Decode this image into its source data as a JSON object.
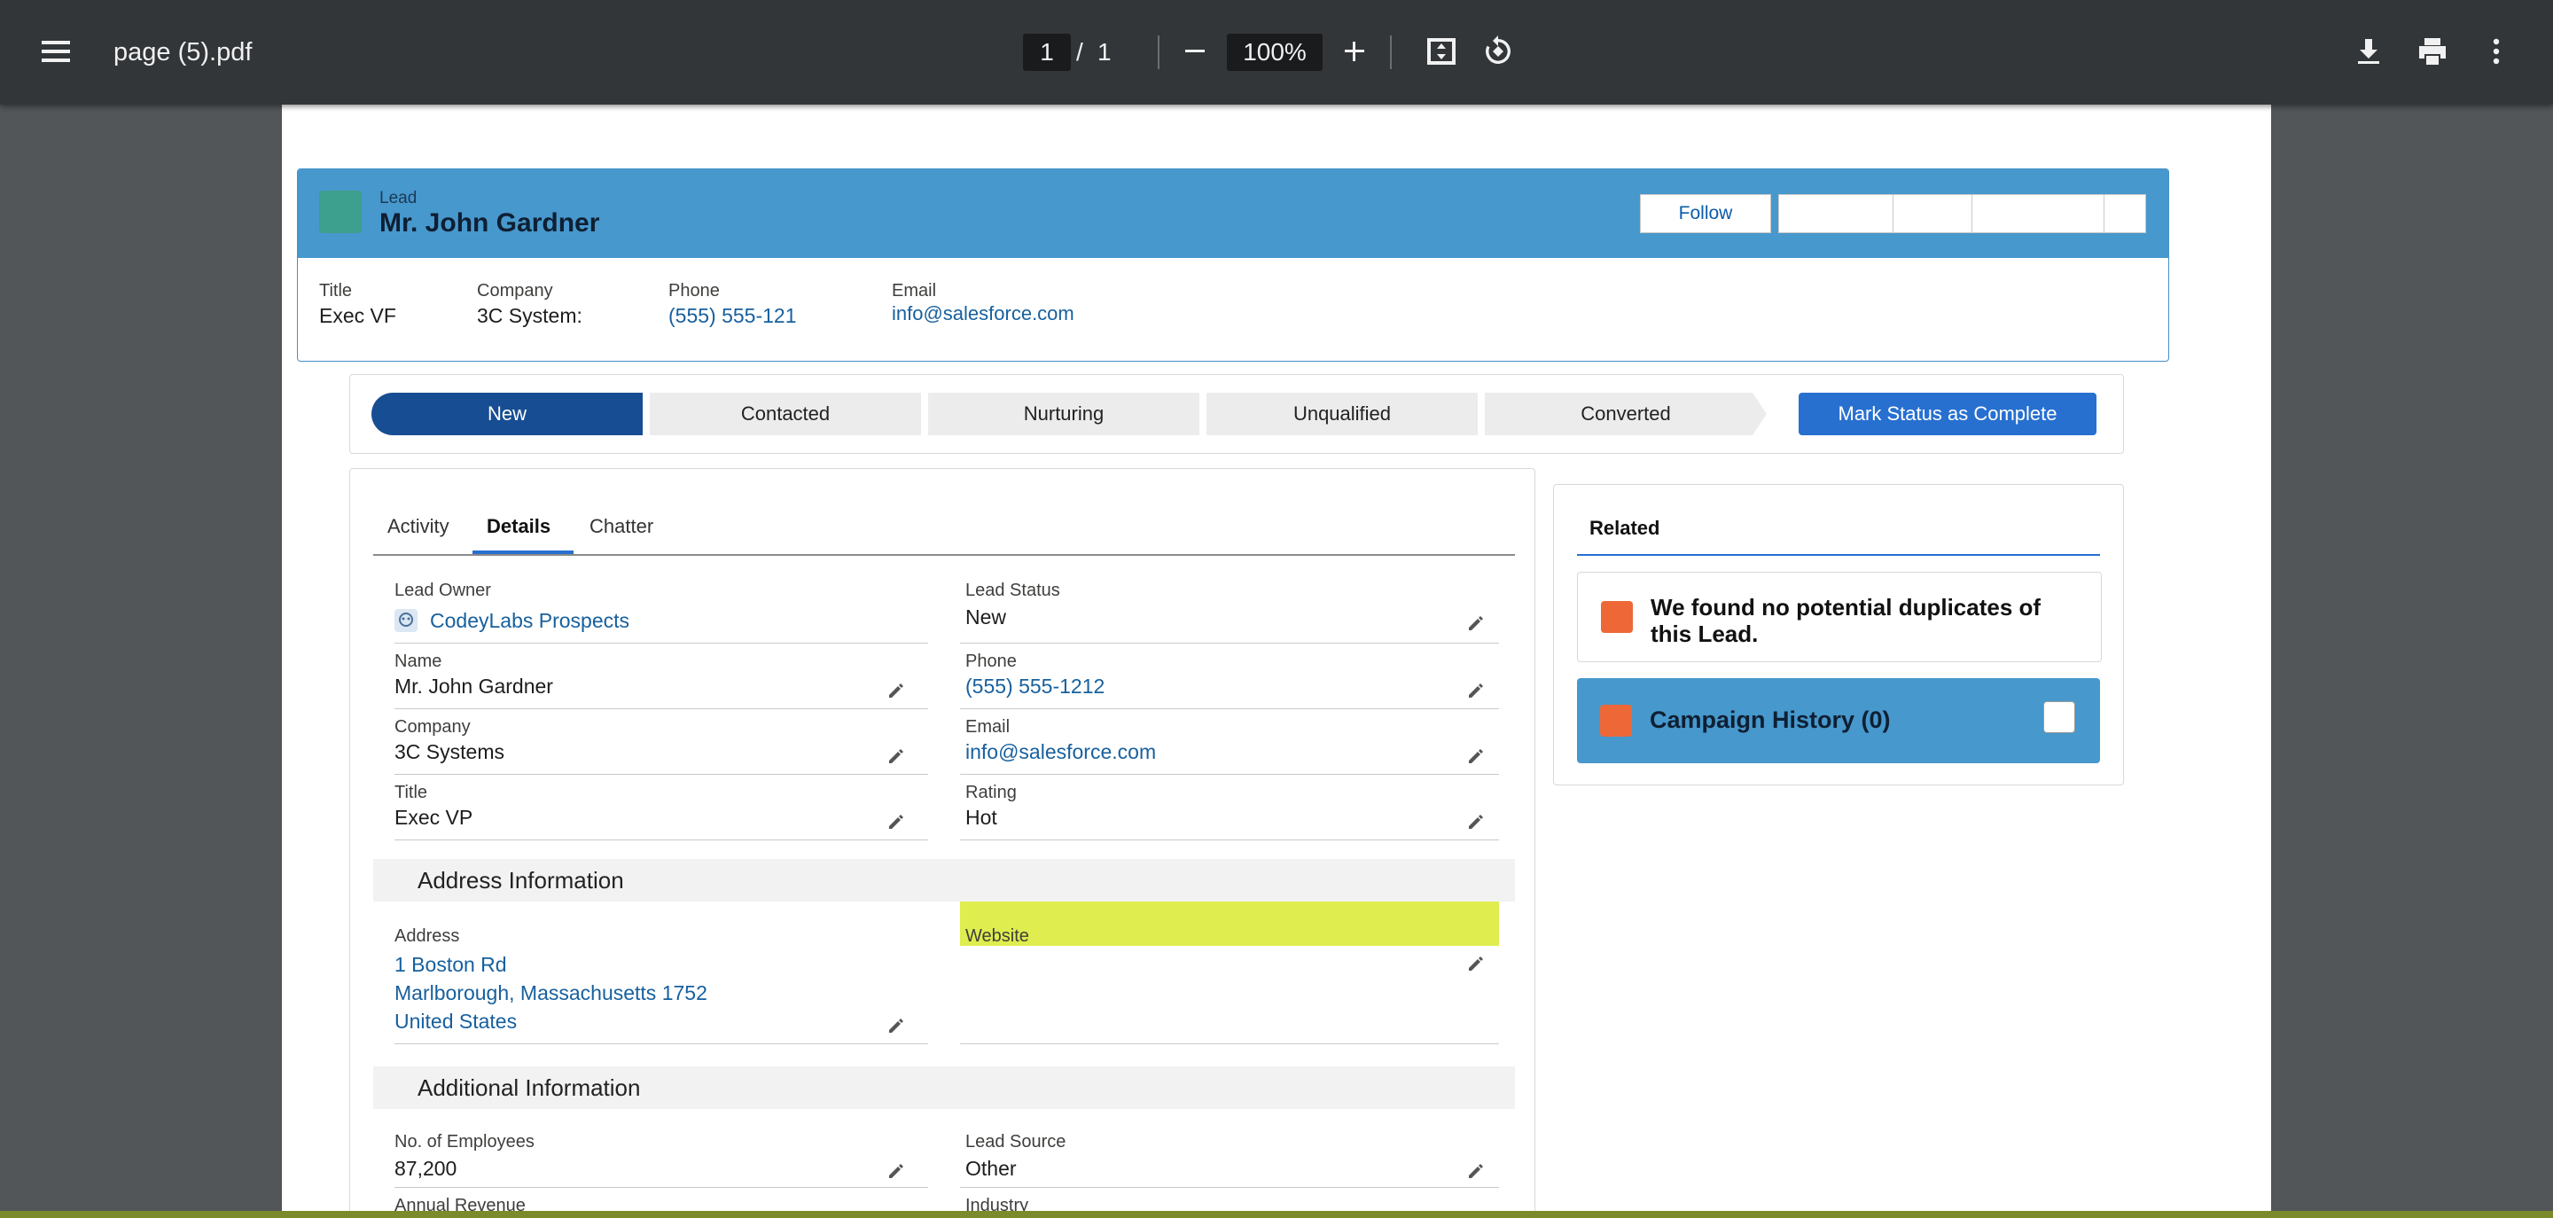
{
  "viewer": {
    "title": "page (5).pdf",
    "page_current": "1",
    "page_sep": "/",
    "page_total": "1",
    "zoom": "100%",
    "icons": [
      "menu-icon",
      "zoom-out-icon",
      "zoom-in-icon",
      "fit-page-icon",
      "rotate-icon",
      "download-icon",
      "print-icon",
      "more-vert-icon"
    ]
  },
  "header": {
    "object_type": "Lead",
    "name": "Mr. John Gardner",
    "follow_label": "Follow",
    "icon_color": "#3aa27a",
    "band_color": "#4798cc",
    "fields": [
      {
        "label": "Title",
        "value": "Exec VF"
      },
      {
        "label": "Company",
        "value": "3C System:"
      },
      {
        "label": "Phone",
        "value": "(555) 555-121"
      },
      {
        "label": "Email",
        "value": "info@salesforce.com"
      }
    ]
  },
  "path": {
    "steps": [
      "New",
      "Contacted",
      "Nurturing",
      "Unqualified",
      "Converted"
    ],
    "active_step": "New",
    "action_label": "Mark Status as Complete"
  },
  "tabs": [
    "Activity",
    "Details",
    "Chatter"
  ],
  "active_tab": "Details",
  "details": {
    "lead_owner": {
      "label": "Lead Owner",
      "value": "CodeyLabs Prospects"
    },
    "lead_status": {
      "label": "Lead Status",
      "value": "New"
    },
    "name": {
      "label": "Name",
      "value": "Mr. John Gardner"
    },
    "phone": {
      "label": "Phone",
      "value": "(555) 555-1212"
    },
    "company": {
      "label": "Company",
      "value": "3C Systems"
    },
    "email": {
      "label": "Email",
      "value": "info@salesforce.com"
    },
    "title": {
      "label": "Title",
      "value": "Exec VP"
    },
    "rating": {
      "label": "Rating",
      "value": "Hot",
      "highlight": "#dfed4f"
    }
  },
  "address_section": {
    "header": "Address Information",
    "address_label": "Address",
    "address_lines": [
      "1 Boston Rd",
      "Marlborough, Massachusetts 1752",
      "United States"
    ],
    "website_label": "Website",
    "website_value": ""
  },
  "additional_section": {
    "header": "Additional Information",
    "employees": {
      "label": "No. of Employees",
      "value": "87,200"
    },
    "lead_source": {
      "label": "Lead Source",
      "value": "Other"
    },
    "annual_revenue_label": "Annual Revenue",
    "industry_label": "Industry"
  },
  "related": {
    "tab_label": "Related",
    "duplicates_text": "We found no potential duplicates of this Lead.",
    "campaign_text": "Campaign History (0)",
    "accent": "#ee6737"
  }
}
